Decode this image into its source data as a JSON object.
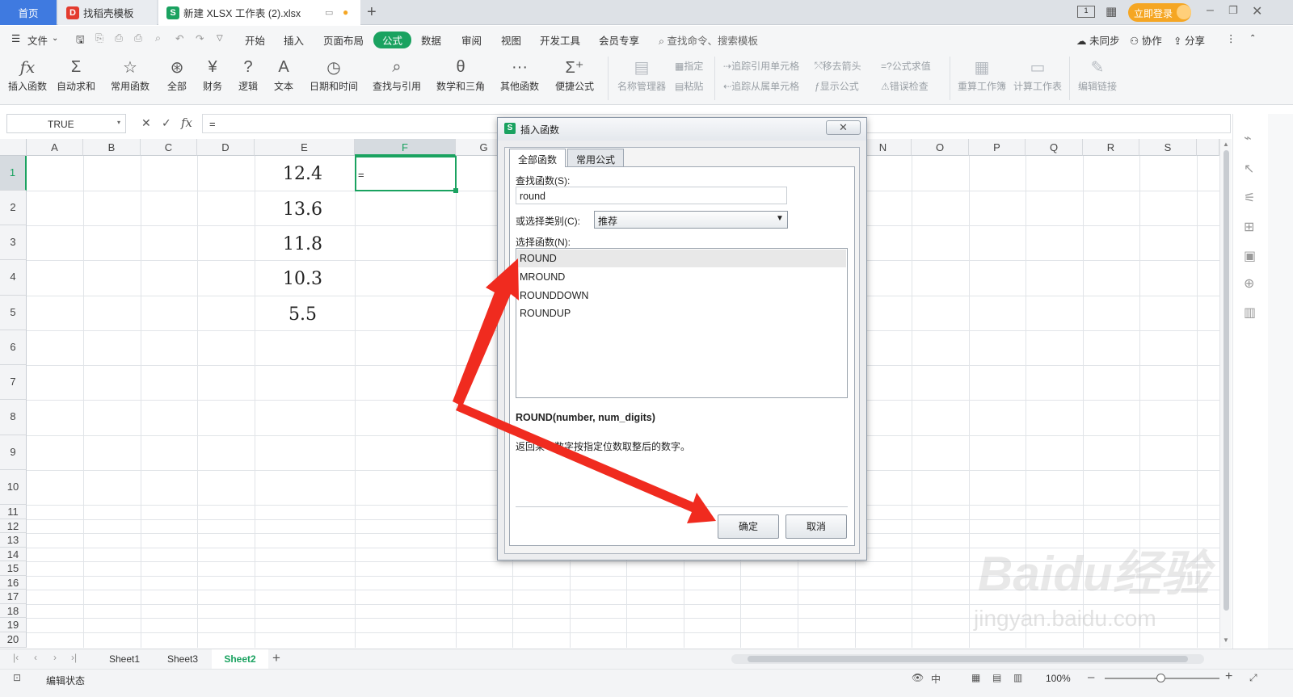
{
  "tabs": {
    "home": "首页",
    "template": "找稻壳模板",
    "file": "新建 XLSX 工作表 (2).xlsx",
    "login": "立即登录"
  },
  "menu": [
    "文件",
    "开始",
    "插入",
    "页面布局",
    "公式",
    "数据",
    "审阅",
    "视图",
    "开发工具",
    "会员专享"
  ],
  "menu_search": "查找命令、搜索模板",
  "menu_right": {
    "sync": "未同步",
    "collab": "协作",
    "share": "分享"
  },
  "ribbon": [
    "插入函数",
    "自动求和",
    "常用函数",
    "全部",
    "财务",
    "逻辑",
    "文本",
    "日期和时间",
    "查找与引用",
    "数学和三角",
    "其他函数",
    "便捷公式"
  ],
  "ribbon_disabled": [
    "名称管理器",
    "指定",
    "粘贴",
    "追踪引用单元格",
    "移去箭头",
    "公式求值",
    "追踪从属单元格",
    "显示公式",
    "错误检查",
    "重算工作簿",
    "计算工作表",
    "编辑链接"
  ],
  "formula_bar": {
    "name_box": "TRUE",
    "content": "="
  },
  "columns": [
    "A",
    "B",
    "C",
    "D",
    "E",
    "F",
    "G",
    "N",
    "O",
    "P",
    "Q",
    "R",
    "S"
  ],
  "rows": [
    "1",
    "2",
    "3",
    "4",
    "5",
    "6",
    "7",
    "8",
    "9",
    "10",
    "11",
    "12",
    "13",
    "14",
    "15",
    "16",
    "17",
    "18",
    "19",
    "20"
  ],
  "cells": {
    "e1": "12.4",
    "e2": "13.6",
    "e3": "11.8",
    "e4": "10.3",
    "e5": "5.5",
    "f1": "="
  },
  "sheets": [
    "Sheet1",
    "Sheet3",
    "Sheet2"
  ],
  "status": {
    "mode": "编辑状态",
    "zoom": "100%"
  },
  "dialog": {
    "title": "插入函数",
    "close": "✕",
    "tab_all": "全部函数",
    "tab_common": "常用公式",
    "search_label": "查找函数(S):",
    "search_value": "round",
    "category_label": "或选择类别(C):",
    "category_value": "推荐",
    "select_label": "选择函数(N):",
    "functions": [
      "ROUND",
      "MROUND",
      "ROUNDDOWN",
      "ROUNDUP"
    ],
    "signature": "ROUND(number, num_digits)",
    "description": "返回某个数字按指定位数取整后的数字。",
    "ok": "确定",
    "cancel": "取消"
  },
  "watermark": {
    "brand": "Baidu经验",
    "url": "jingyan.baidu.com"
  },
  "colors": {
    "accent": "#1aa260",
    "home_tab": "#3f7ae0",
    "arrow": "#f02b1f",
    "login": "#f5a623"
  }
}
